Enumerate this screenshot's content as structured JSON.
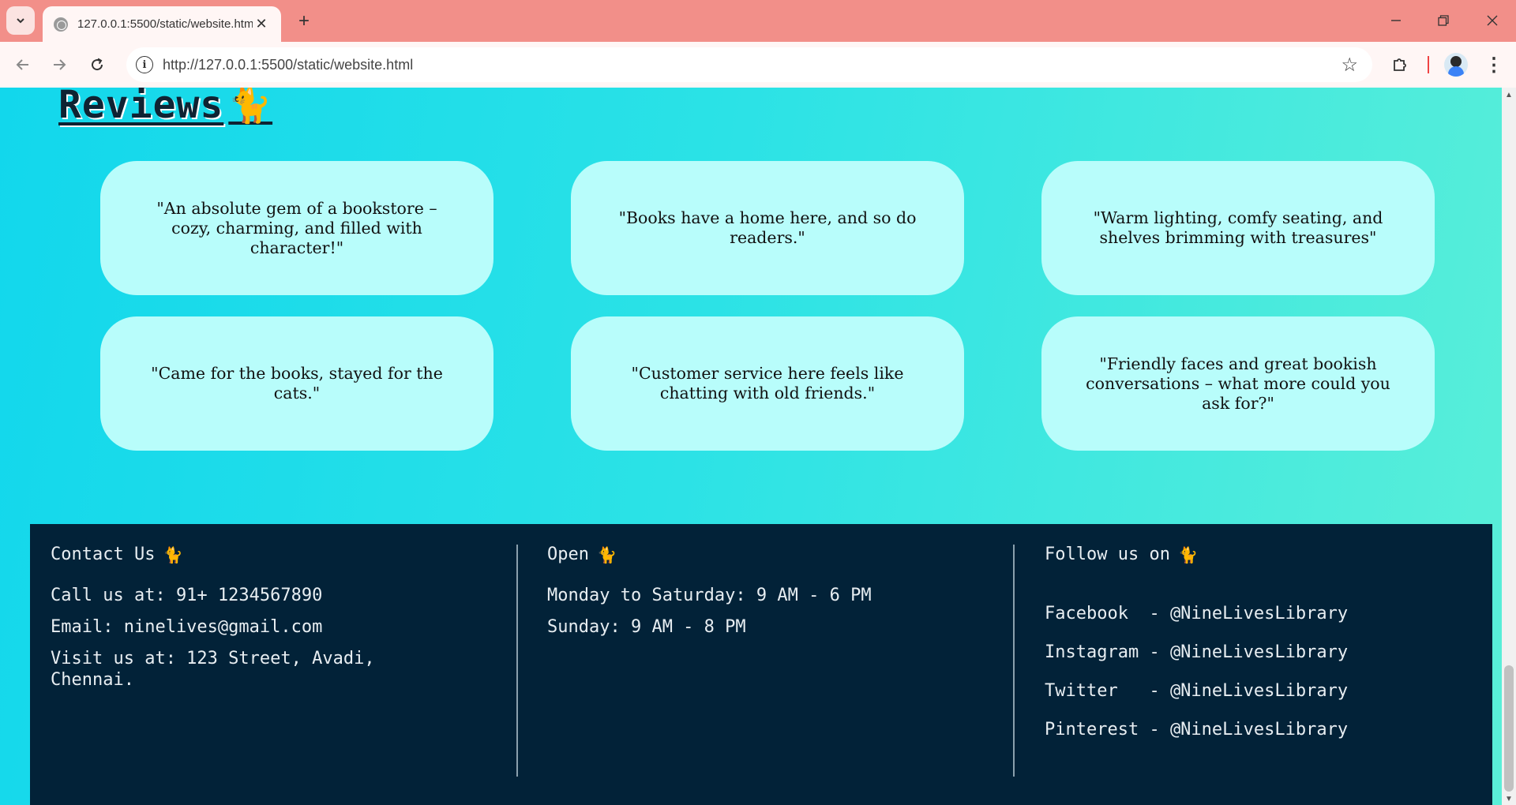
{
  "browser": {
    "tab_title": "127.0.0.1:5500/static/website.html",
    "url": "http://127.0.0.1:5500/static/website.html"
  },
  "reviews": {
    "title": "Reviews",
    "cat_glyph": "🐈",
    "items": [
      "\"An absolute gem of a bookstore – cozy, charming, and filled with character!\"",
      "\"Books have a home here, and so do readers.\"",
      "\"Warm lighting, comfy seating, and shelves brimming with treasures\"",
      "\"Came for the books, stayed for the cats.\"",
      "\"Customer service here feels like chatting with old friends.\"",
      "\"Friendly faces and great bookish conversations – what more could you ask for?\""
    ]
  },
  "footer": {
    "contact": {
      "heading": "Contact Us",
      "phone": "Call us at: 91+ 1234567890",
      "email": "Email: ninelives@gmail.com",
      "address": "Visit us at: 123 Street, Avadi, Chennai."
    },
    "open": {
      "heading": "Open",
      "weekdays": "Monday to Saturday: 9 AM - 6 PM",
      "sunday": "Sunday: 9 AM - 8 PM"
    },
    "follow": {
      "heading": "Follow us on",
      "items": [
        "Facebook  - @NineLivesLibrary",
        "Instagram - @NineLivesLibrary",
        "Twitter   - @NineLivesLibrary",
        "Pinterest - @NineLivesLibrary"
      ]
    }
  },
  "colors": {
    "page_gradient_start": "#12d7ec",
    "page_gradient_end": "#5aefd8",
    "card_bg": "#b8fdfb",
    "footer_bg": "#022238",
    "tabbar_bg": "#f28f89"
  }
}
